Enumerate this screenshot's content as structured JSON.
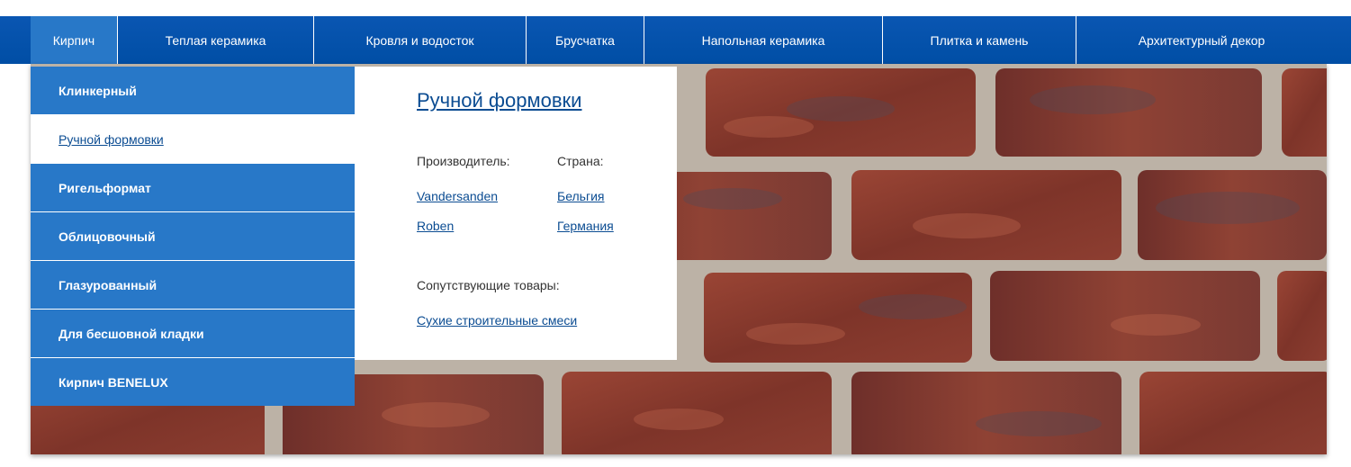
{
  "topnav": {
    "items": [
      {
        "label": "Кирпич",
        "active": true
      },
      {
        "label": "Теплая керамика"
      },
      {
        "label": "Кровля и водосток"
      },
      {
        "label": "Брусчатка"
      },
      {
        "label": "Напольная керамика"
      },
      {
        "label": "Плитка и камень"
      },
      {
        "label": "Архитектурный декор"
      }
    ]
  },
  "submenu": {
    "items": [
      {
        "label": "Клинкерный"
      },
      {
        "label": "Ручной формовки",
        "active": true
      },
      {
        "label": "Ригельформат"
      },
      {
        "label": "Облицовочный"
      },
      {
        "label": "Глазурованный"
      },
      {
        "label": "Для бесшовной кладки"
      },
      {
        "label": "Кирпич BENELUX"
      }
    ]
  },
  "details": {
    "title": "Ручной формовки",
    "manufacturer_label": "Производитель:",
    "country_label": "Страна:",
    "manufacturers": [
      "Vandersanden",
      "Roben"
    ],
    "countries": [
      "Бельгия",
      "Германия"
    ],
    "related_label": "Сопутствующие товары:",
    "related_link": "Сухие строительные смеси"
  },
  "colors": {
    "nav_blue": "#004ea5",
    "menu_blue": "#2878c8",
    "link_blue": "#0b4c92",
    "brick": "#8a3a2e",
    "mortar": "#bdb3a8"
  }
}
